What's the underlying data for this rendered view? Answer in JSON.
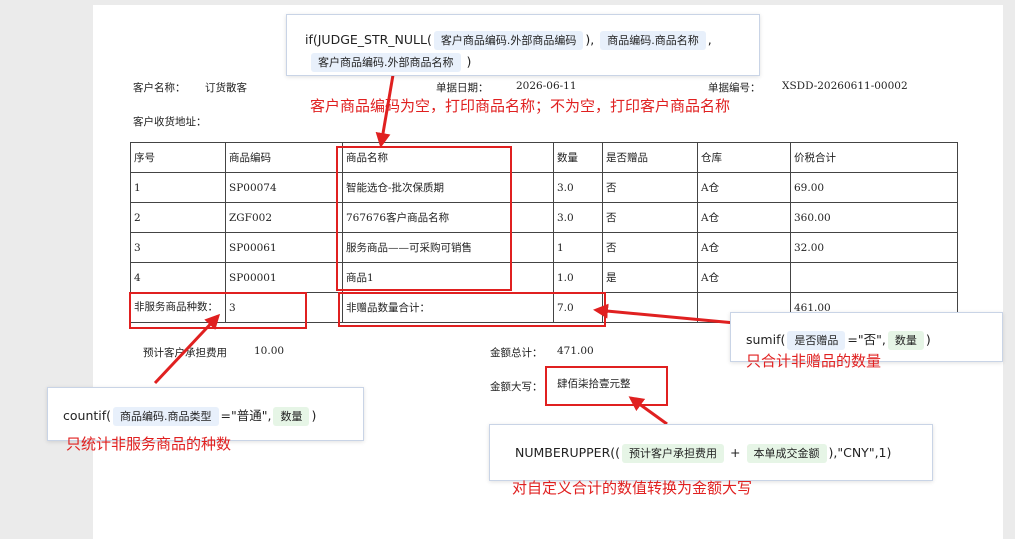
{
  "doc": {
    "customer_name_label": "客户名称：",
    "customer_name_value": "订货散客",
    "doc_date_label": "单据日期：",
    "doc_date_value": "2026-06-11",
    "doc_no_label": "单据编号：",
    "doc_no_value": "XSDD-20260611-00002",
    "address_label": "客户收货地址：",
    "table": {
      "headers": [
        "序号",
        "商品编码",
        "商品名称",
        "数量",
        "是否赠品",
        "仓库",
        "价税合计"
      ],
      "rows": [
        [
          "1",
          "SP00074",
          "智能选仓-批次保质期",
          "3.0",
          "否",
          "A仓",
          "69.00"
        ],
        [
          "2",
          "ZGF002",
          "767676客户商品名称",
          "3.0",
          "否",
          "A仓",
          "360.00"
        ],
        [
          "3",
          "SP00061",
          "服务商品——可采购可销售",
          "1",
          "否",
          "A仓",
          "32.00"
        ],
        [
          "4",
          "SP00001",
          "商品1",
          "1.0",
          "是",
          "A仓",
          ""
        ]
      ],
      "summary": {
        "label": "非服务商品种数：",
        "count": "3",
        "qty_label": "非赠品数量合计：",
        "qty": "7.0",
        "total": "461.00"
      }
    },
    "expected_fee_label": "预计客户承担费用",
    "expected_fee_value": "10.00",
    "amount_total_label": "金额总计：",
    "amount_total_value": "471.00",
    "amount_upper_label": "金额大写：",
    "amount_upper_value": "肆佰柒拾壹元整"
  },
  "formulas": {
    "top": {
      "fn": "if(JUDGE_STR_NULL(",
      "arg1": "客户商品编码.外部商品编码",
      "sep1": "),",
      "arg2": "商品编码.商品名称",
      "sep2": ",",
      "arg3": "客户商品编码.外部商品名称",
      "close": ")"
    },
    "sumif": {
      "fn": "sumif(",
      "arg1": "是否赠品",
      "mid": "=\"否\",",
      "arg2": "数量",
      "close": ")"
    },
    "countif": {
      "fn": "countif(",
      "arg1": "商品编码.商品类型",
      "mid": "=\"普通\",",
      "arg2": "数量",
      "close": ")"
    },
    "upper": {
      "fn": "NUMBERUPPER((",
      "arg1": "预计客户承担费用",
      "plus": "+",
      "arg2": "本单成交金额",
      "close": "),\"CNY\",1)"
    }
  },
  "notes": {
    "top": "客户商品编码为空，打印商品名称；不为空，打印客户商品名称",
    "sumif": "只合计非赠品的数量",
    "countif": "只统计非服务商品的种数",
    "upper": "对自定义合计的数值转换为金额大写"
  },
  "colors": {
    "annotation_red": "#e02020",
    "chip_blue": "#e8f0fb",
    "chip_green": "#e6f5e6"
  }
}
